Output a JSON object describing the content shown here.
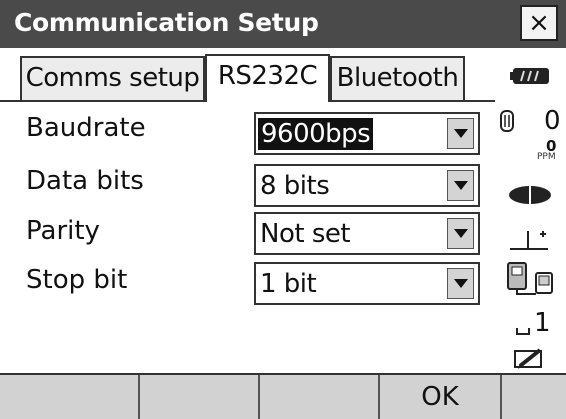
{
  "window": {
    "title": "Communication Setup",
    "close_glyph": "×"
  },
  "tabs": [
    {
      "label": "Comms setup",
      "active": false
    },
    {
      "label": "RS232C",
      "active": true
    },
    {
      "label": "Bluetooth",
      "active": false
    }
  ],
  "fields": [
    {
      "label": "Baudrate",
      "value": "9600bps",
      "selected": true
    },
    {
      "label": "Data bits",
      "value": "8 bits",
      "selected": false
    },
    {
      "label": "Parity",
      "value": "Not set",
      "selected": false
    },
    {
      "label": "Stop bit",
      "value": "1 bit",
      "selected": false
    }
  ],
  "sidebar": {
    "battery_icon": "battery-icon",
    "prism_constant": "0",
    "ppm_value": "0",
    "ppm_unit": "PPM",
    "target_icon": "target-icon",
    "tilt_icon": "tilt-icon",
    "comms_icon": "communication-icon",
    "input_mode": "1",
    "edit_icon": "pencil-icon"
  },
  "function_keys": [
    "",
    "",
    "",
    "OK",
    ""
  ]
}
